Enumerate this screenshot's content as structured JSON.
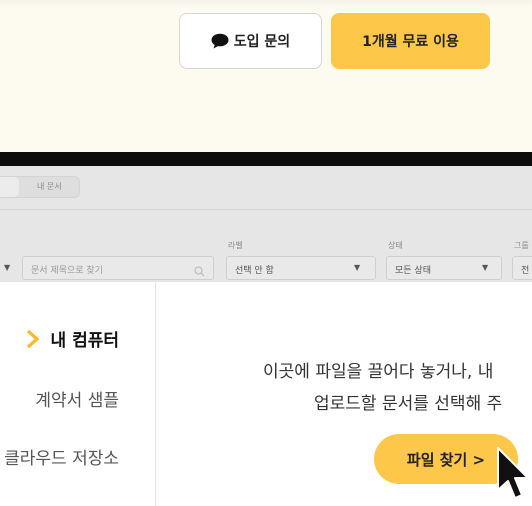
{
  "header": {
    "inquiry_label": "도입 문의",
    "trial_label": "1개월 무료 이용"
  },
  "app": {
    "tab_label": "내 문서",
    "search_placeholder": "문서 제목으로 찾기",
    "label_filter": {
      "title": "라벨",
      "value": "선택 안 함"
    },
    "status_filter": {
      "title": "상태",
      "value": "모든 상태"
    },
    "group_filter": {
      "title": "그룹",
      "value": "전"
    }
  },
  "upload": {
    "sources": [
      {
        "label": "내 컴퓨터",
        "active": true
      },
      {
        "label": "계약서 샘플",
        "active": false
      },
      {
        "label": "클라우드 저장소",
        "active": false
      }
    ],
    "drop_line1": "이곳에 파일을 끌어다 놓거나, 내",
    "drop_line2": "업로드할 문서를 선택해 주",
    "find_button": "파일 찾기 >"
  },
  "colors": {
    "accent": "#fdc84a",
    "background": "#fdfaf0",
    "dark_bar": "#0c0c0c"
  }
}
